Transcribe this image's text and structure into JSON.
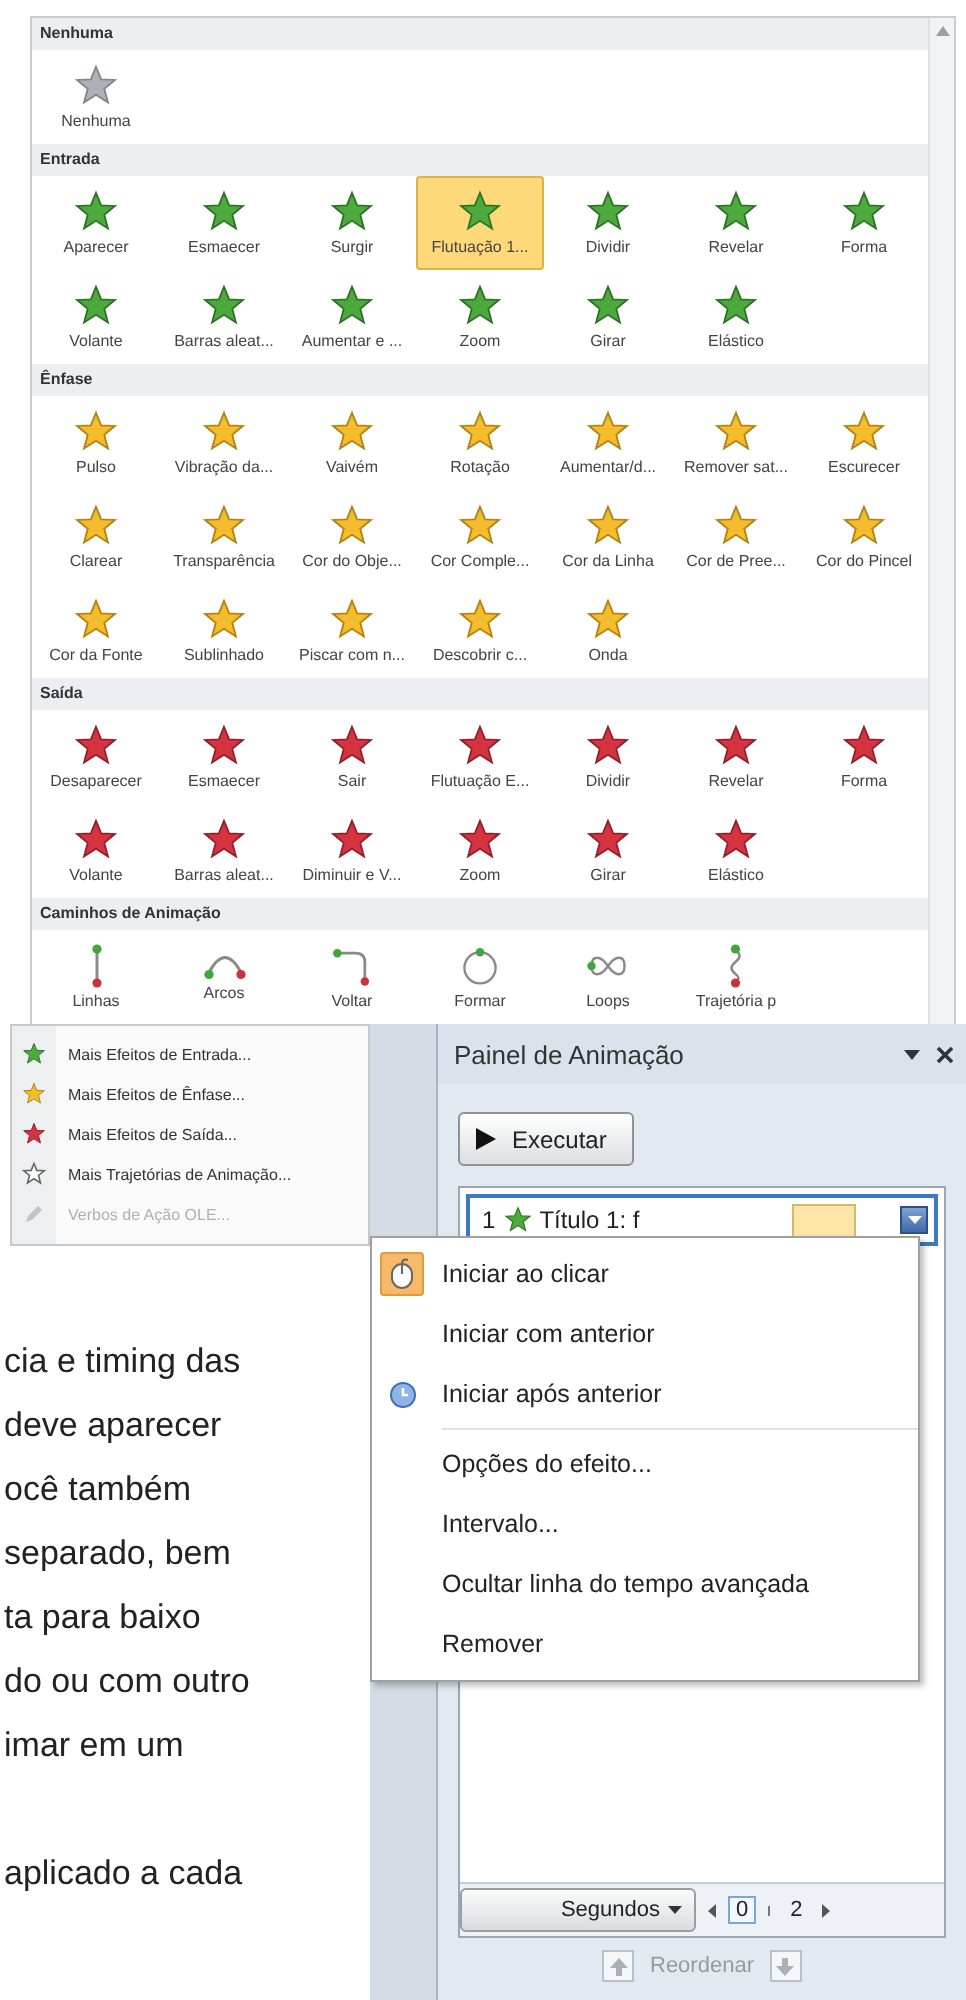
{
  "gallery": {
    "sections": [
      {
        "title": "Nenhuma",
        "kind": "none",
        "items": [
          {
            "label": "Nenhuma",
            "selected": false
          }
        ]
      },
      {
        "title": "Entrada",
        "kind": "entrance",
        "items": [
          {
            "label": "Aparecer",
            "selected": false
          },
          {
            "label": "Esmaecer",
            "selected": false
          },
          {
            "label": "Surgir",
            "selected": false
          },
          {
            "label": "Flutuação 1...",
            "selected": true
          },
          {
            "label": "Dividir",
            "selected": false
          },
          {
            "label": "Revelar",
            "selected": false
          },
          {
            "label": "Forma",
            "selected": false
          },
          {
            "label": "Volante",
            "selected": false
          },
          {
            "label": "Barras aleat...",
            "selected": false
          },
          {
            "label": "Aumentar e ...",
            "selected": false
          },
          {
            "label": "Zoom",
            "selected": false
          },
          {
            "label": "Girar",
            "selected": false
          },
          {
            "label": "Elástico",
            "selected": false
          }
        ]
      },
      {
        "title": "Ênfase",
        "kind": "emphasis",
        "items": [
          {
            "label": "Pulso",
            "selected": false
          },
          {
            "label": "Vibração da...",
            "selected": false
          },
          {
            "label": "Vaivém",
            "selected": false
          },
          {
            "label": "Rotação",
            "selected": false
          },
          {
            "label": "Aumentar/d...",
            "selected": false
          },
          {
            "label": "Remover sat...",
            "selected": false
          },
          {
            "label": "Escurecer",
            "selected": false
          },
          {
            "label": "Clarear",
            "selected": false
          },
          {
            "label": "Transparência",
            "selected": false
          },
          {
            "label": "Cor do Obje...",
            "selected": false
          },
          {
            "label": "Cor Comple...",
            "selected": false
          },
          {
            "label": "Cor da Linha",
            "selected": false
          },
          {
            "label": "Cor de Pree...",
            "selected": false
          },
          {
            "label": "Cor do Pincel",
            "selected": false
          },
          {
            "label": "Cor da Fonte",
            "selected": false
          },
          {
            "label": "Sublinhado",
            "selected": false
          },
          {
            "label": "Piscar com n...",
            "selected": false
          },
          {
            "label": "Descobrir c...",
            "selected": false
          },
          {
            "label": "Onda",
            "selected": false
          }
        ]
      },
      {
        "title": "Saída",
        "kind": "exit",
        "items": [
          {
            "label": "Desaparecer",
            "selected": false
          },
          {
            "label": "Esmaecer",
            "selected": false
          },
          {
            "label": "Sair",
            "selected": false
          },
          {
            "label": "Flutuação E...",
            "selected": false
          },
          {
            "label": "Dividir",
            "selected": false
          },
          {
            "label": "Revelar",
            "selected": false
          },
          {
            "label": "Forma",
            "selected": false
          },
          {
            "label": "Volante",
            "selected": false
          },
          {
            "label": "Barras aleat...",
            "selected": false
          },
          {
            "label": "Diminuir e V...",
            "selected": false
          },
          {
            "label": "Zoom",
            "selected": false
          },
          {
            "label": "Girar",
            "selected": false
          },
          {
            "label": "Elástico",
            "selected": false
          }
        ]
      },
      {
        "title": "Caminhos de Animação",
        "kind": "path",
        "items": [
          {
            "label": "Linhas",
            "kind": "line",
            "selected": false
          },
          {
            "label": "Arcos",
            "kind": "arc",
            "selected": false
          },
          {
            "label": "Voltar",
            "kind": "turn",
            "selected": false
          },
          {
            "label": "Formar",
            "kind": "shape",
            "selected": false
          },
          {
            "label": "Loops",
            "kind": "loop",
            "selected": false
          },
          {
            "label": "Trajetória p",
            "kind": "custom",
            "selected": false
          }
        ]
      }
    ]
  },
  "more_effects_menu": {
    "items": [
      {
        "label": "Mais Efeitos de Entrada...",
        "kind": "entrance",
        "disabled": false
      },
      {
        "label": "Mais Efeitos de Ênfase...",
        "kind": "emphasis",
        "disabled": false
      },
      {
        "label": "Mais Efeitos de Saída...",
        "kind": "exit",
        "disabled": false
      },
      {
        "label": "Mais Trajetórias de Animação...",
        "kind": "path",
        "disabled": false
      },
      {
        "label": "Verbos de Ação OLE...",
        "kind": "ole",
        "disabled": true
      }
    ]
  },
  "body_text": {
    "paragraphs": [
      {
        "lines": [
          "cia e timing das",
          "deve aparecer",
          "ocê também",
          "separado, bem",
          "ta para baixo",
          "do ou com outro",
          "imar em um"
        ]
      },
      {
        "lines": [
          "aplicado a cada"
        ]
      }
    ]
  },
  "animation_pane": {
    "title": "Painel de Animação",
    "play_button": "Executar",
    "items": [
      {
        "number": "1",
        "label": "Título 1: f",
        "selected": true
      }
    ],
    "timeline": {
      "unit": "Segundos",
      "ticks": [
        "0",
        "2"
      ]
    },
    "reorder": {
      "label": "Reordenar",
      "disabled": true
    }
  },
  "context_menu": {
    "items": [
      {
        "label": "Iniciar ao clicar",
        "kind": "click",
        "checked": true
      },
      {
        "label": "Iniciar com anterior",
        "kind": "with",
        "checked": false
      },
      {
        "label": "Iniciar após anterior",
        "kind": "after",
        "checked": false
      },
      {
        "label": "Opções do efeito...",
        "kind": "action",
        "checked": false
      },
      {
        "label": "Intervalo...",
        "kind": "action",
        "checked": false
      },
      {
        "label": "Ocultar linha do tempo avançada",
        "kind": "action",
        "checked": false
      },
      {
        "label": "Remover",
        "kind": "action",
        "checked": false
      }
    ]
  }
}
